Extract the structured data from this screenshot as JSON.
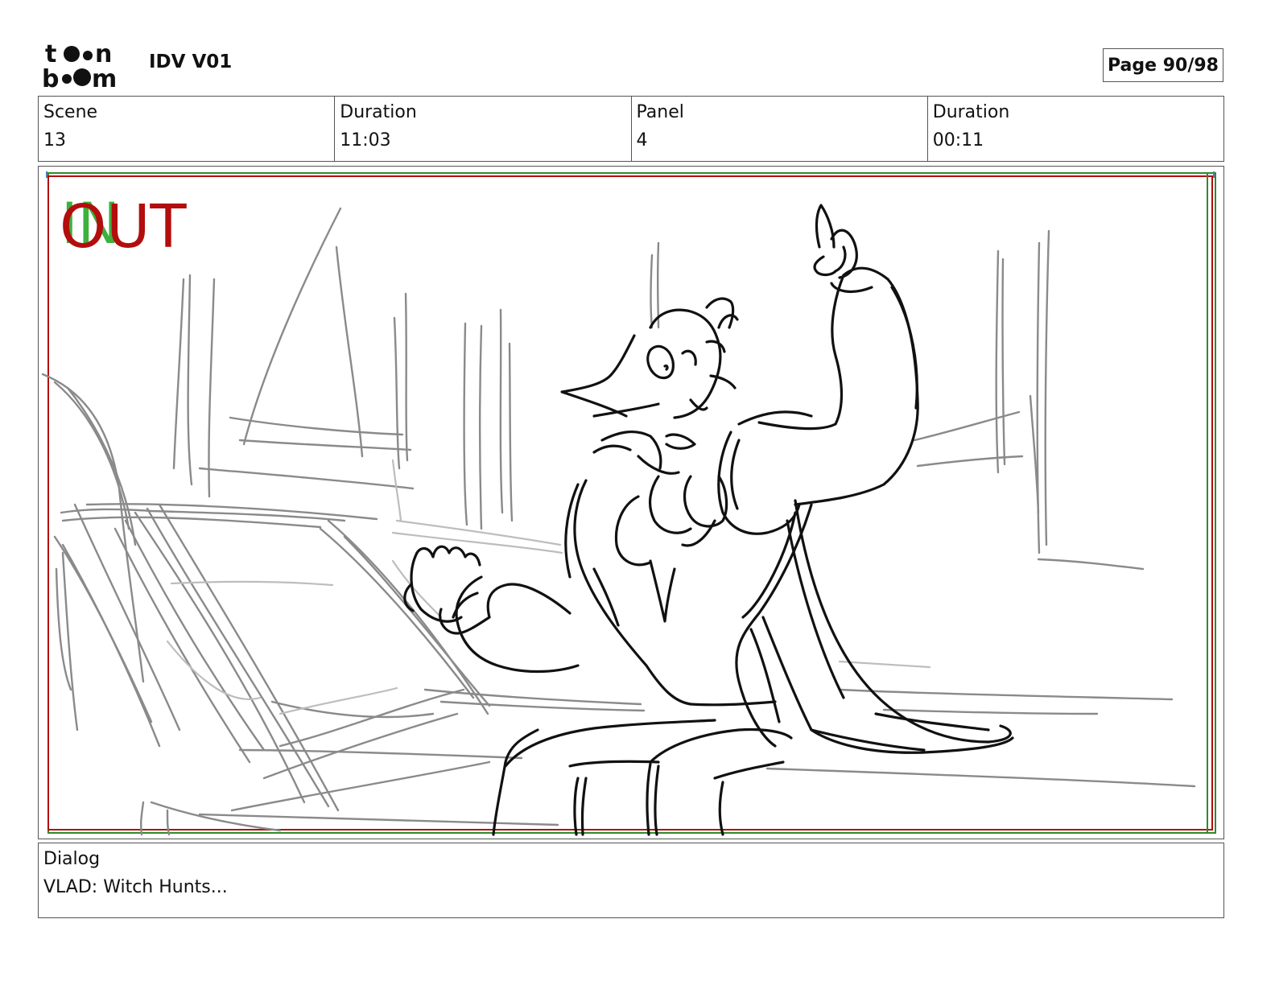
{
  "header": {
    "logo": {
      "line1": "toon",
      "line2": "boom",
      "name": "toon-boom-logo"
    },
    "project_title": "IDV V01",
    "page_label": "Page 90/98"
  },
  "info": {
    "scene_label": "Scene",
    "scene_value": "13",
    "scene_duration_label": "Duration",
    "scene_duration_value": "11:03",
    "panel_label": "Panel",
    "panel_value": "4",
    "panel_duration_label": "Duration",
    "panel_duration_value": "00:11"
  },
  "panel": {
    "in_marker": "IN",
    "out_marker": "OUT",
    "colors": {
      "in": "#3db13d",
      "out": "#b30d0d",
      "sketch": "#111111",
      "background_sketch": "#8a8a8a"
    }
  },
  "dialog": {
    "label": "Dialog",
    "text": "VLAD: Witch Hunts..."
  }
}
